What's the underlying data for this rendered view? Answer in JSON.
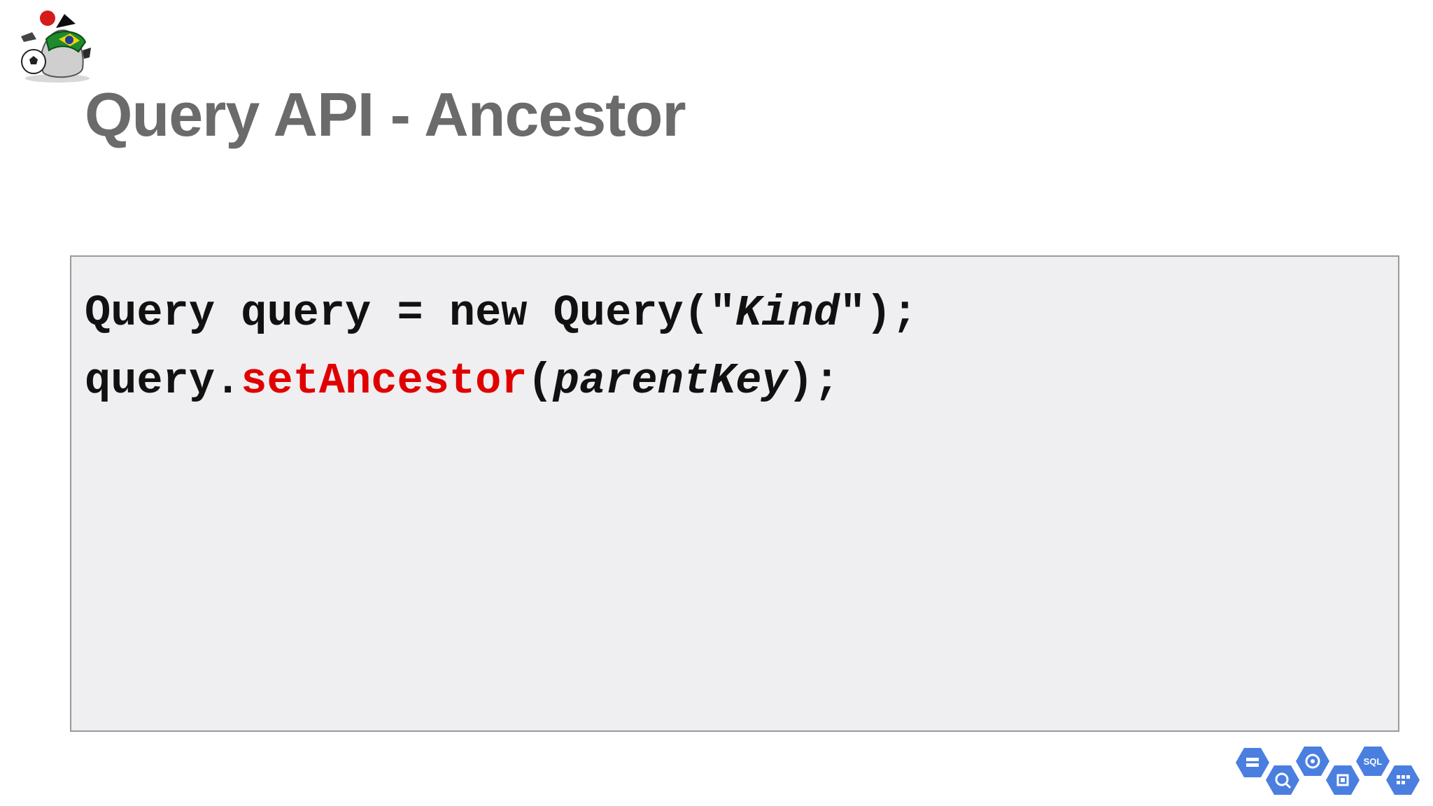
{
  "slide": {
    "title": "Query API - Ancestor"
  },
  "code": {
    "line1": {
      "decl": "Query query = new Query(\"",
      "kind": "Kind",
      "end": "\");"
    },
    "line2": {
      "object": "query.",
      "method": "setAncestor",
      "open": "(",
      "arg": "parentKey",
      "close": ");"
    }
  },
  "decorations": {
    "mascot": "duke-mascot-icon",
    "cloud_icons": [
      "storage-icon",
      "bigquery-icon",
      "app-engine-icon",
      "compute-engine-icon",
      "cloud-sql-icon",
      "datastore-icon"
    ],
    "sql_label": "SQL",
    "accent_color": "#e00000",
    "icon_color": "#4a7fe0"
  }
}
